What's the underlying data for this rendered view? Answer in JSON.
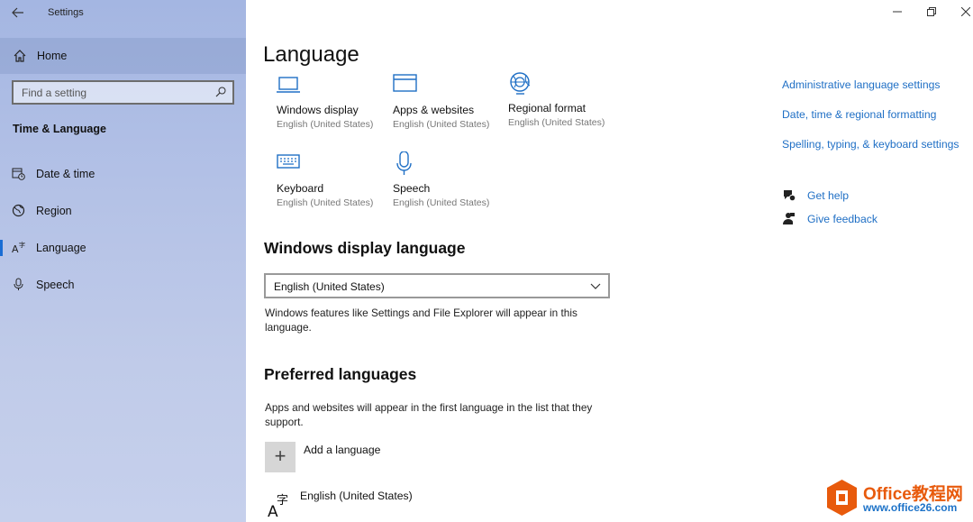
{
  "window": {
    "title": "Settings",
    "controls": {
      "minimize": "—",
      "restore": "❐",
      "close": "✕"
    }
  },
  "sidebar": {
    "home_label": "Home",
    "search_placeholder": "Find a setting",
    "section_title": "Time & Language",
    "items": [
      {
        "label": "Date & time",
        "icon": "clock-calendar-icon",
        "selected": false
      },
      {
        "label": "Region",
        "icon": "globe-icon",
        "selected": false
      },
      {
        "label": "Language",
        "icon": "language-icon",
        "selected": true
      },
      {
        "label": "Speech",
        "icon": "microphone-icon",
        "selected": false
      }
    ]
  },
  "main": {
    "title": "Language",
    "tiles": [
      {
        "name": "Windows display",
        "sub": "English (United States)",
        "icon": "laptop-icon"
      },
      {
        "name": "Apps & websites",
        "sub": "English (United States)",
        "icon": "browser-window-icon"
      },
      {
        "name": "Regional format",
        "sub": "English (United States)",
        "icon": "globe-format-icon"
      },
      {
        "name": "Keyboard",
        "sub": "English (United States)",
        "icon": "keyboard-icon"
      },
      {
        "name": "Speech",
        "sub": "English (United States)",
        "icon": "microphone-icon"
      }
    ],
    "display_language": {
      "heading": "Windows display language",
      "selected": "English (United States)",
      "description": "Windows features like Settings and File Explorer will appear in this language."
    },
    "preferred": {
      "heading": "Preferred languages",
      "description": "Apps and websites will appear in the first language in the list that they support.",
      "add_label": "Add a language",
      "languages": [
        {
          "name": "English (United States)",
          "icon": "language-glyph-icon"
        }
      ]
    }
  },
  "related": {
    "links": [
      "Administrative language settings",
      "Date, time & regional formatting",
      "Spelling, typing, & keyboard settings"
    ],
    "help": {
      "get_help": "Get help",
      "give_feedback": "Give feedback"
    }
  },
  "watermark": {
    "line1": "Office教程网",
    "line2": "www.office26.com"
  },
  "colors": {
    "accent": "#1f6fc5",
    "selection_bar": "#1a6dd4",
    "watermark_orange": "#e85a0c"
  }
}
